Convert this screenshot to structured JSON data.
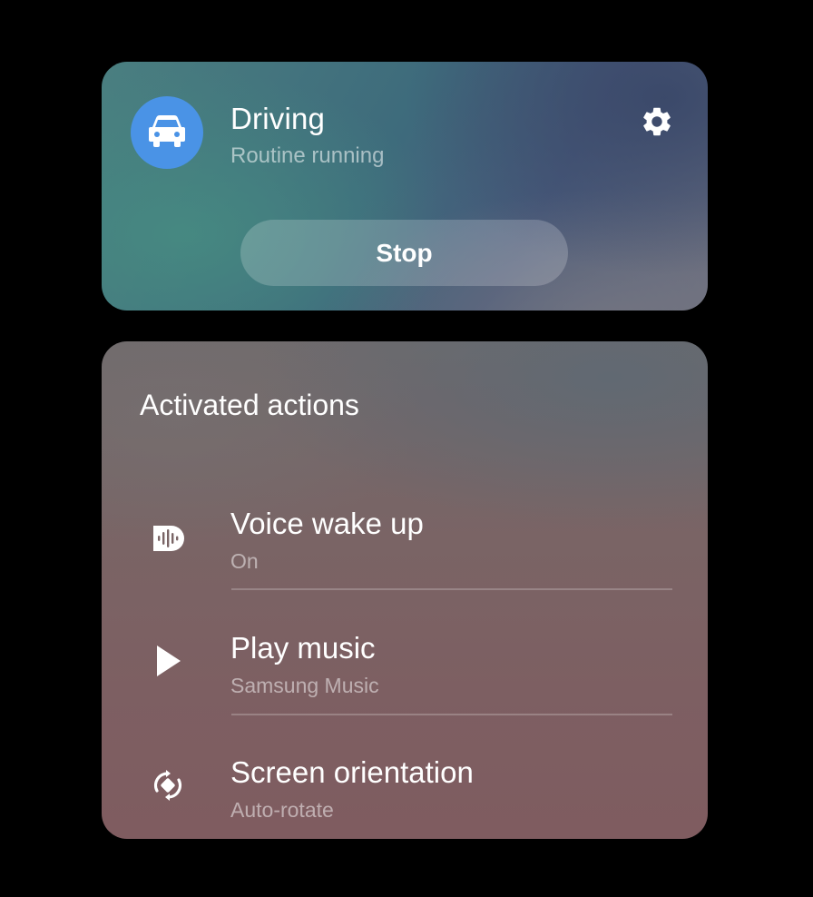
{
  "routine": {
    "title": "Driving",
    "status": "Routine running",
    "icon": "car-icon",
    "stop_label": "Stop",
    "settings_icon": "gear-icon",
    "accent_color": "#4a93e6"
  },
  "actions": {
    "heading": "Activated actions",
    "items": [
      {
        "label": "Voice wake up",
        "value": "On",
        "icon": "voice-wake-icon"
      },
      {
        "label": "Play music",
        "value": "Samsung Music",
        "icon": "play-icon"
      },
      {
        "label": "Screen orientation",
        "value": "Auto-rotate",
        "icon": "auto-rotate-icon"
      }
    ]
  }
}
